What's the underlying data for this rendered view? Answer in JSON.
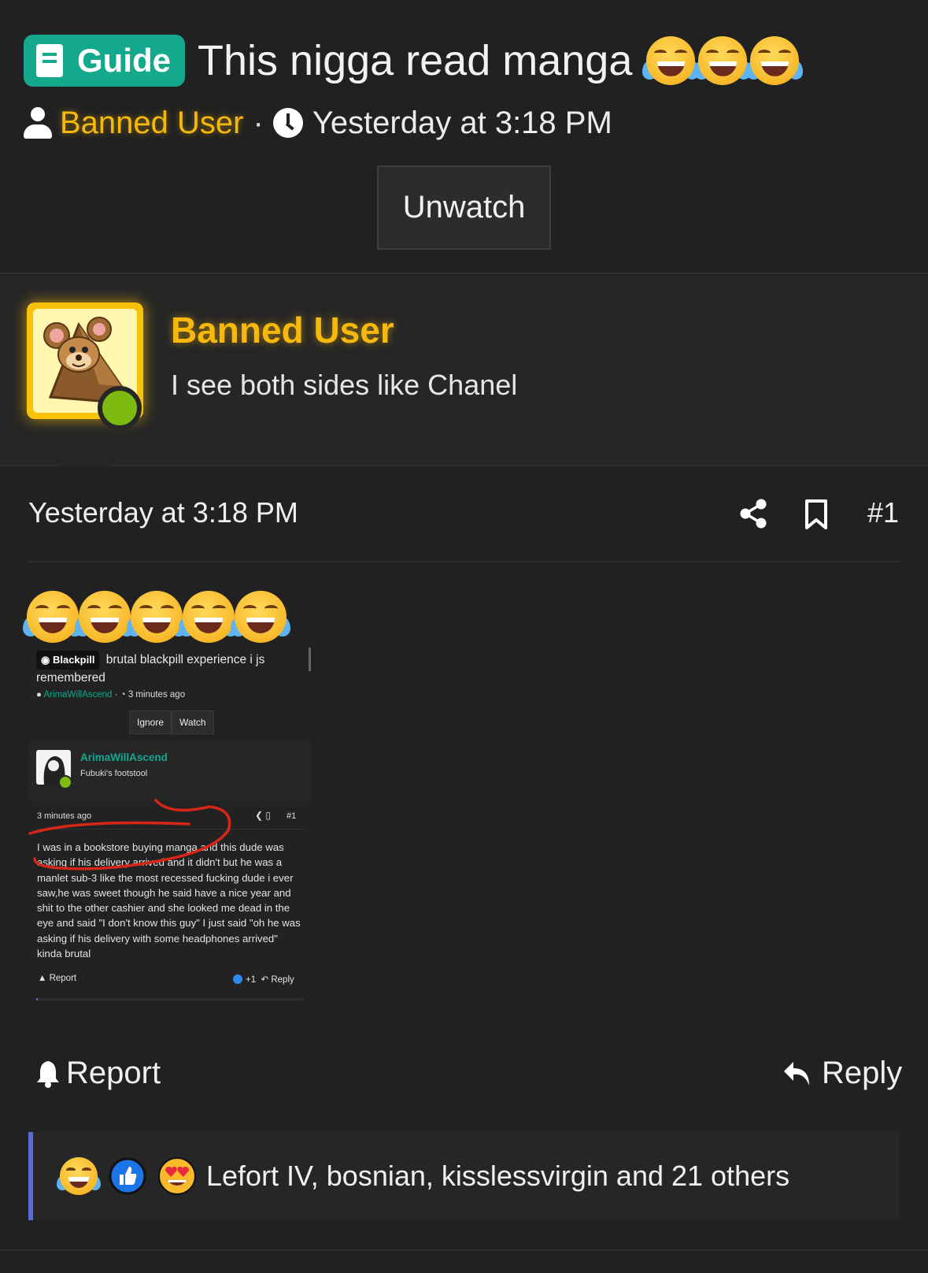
{
  "thread": {
    "prefix": "Guide",
    "title": "This nigga read manga",
    "title_emoji_count": 3,
    "author": "Banned User",
    "separator": "·",
    "time": "Yesterday at 3:18 PM",
    "unwatch_label": "Unwatch"
  },
  "post": {
    "author": "Banned User",
    "user_title": "I see both sides like Chanel",
    "online": true,
    "time": "Yesterday at 3:18 PM",
    "number": "#1",
    "emoji_count": 5,
    "report_label": "Report",
    "reply_label": "Reply"
  },
  "embedded_screenshot": {
    "prefix": "Blackpill",
    "title": "brutal blackpill experience i js remembered",
    "author": "ArimaWillAscend",
    "separator": "·",
    "time": "3 minutes ago",
    "ignore_label": "Ignore",
    "watch_label": "Watch",
    "user_name": "ArimaWillAscend",
    "user_title": "Fubuki's footstool",
    "post_time": "3 minutes ago",
    "post_number": "#1",
    "body": "I was in a bookstore buying manga and this dude was asking if his delivery arrived and it didn't but he was a manlet sub-3 like the most recessed fucking dude i ever saw,he was sweet though he said have a nice year and shit to the other cashier and she looked me dead in the eye and said \"I don't know this guy\" I just said \"oh he was asking if his delivery with some headphones arrived\" kinda brutal",
    "report_label": "Report",
    "like_count": "+1",
    "reply_label": "Reply"
  },
  "reactions": {
    "icons": [
      "joy-emoji-icon",
      "like-icon",
      "heart-eyes-emoji-icon"
    ],
    "text": "Lefort IV, bosnian, kisslessvirgin and 21 others"
  },
  "colors": {
    "background": "#212121",
    "prefix_bg": "#14a88d",
    "banned_gold": "#f6b80b",
    "online_green": "#7dbb10",
    "reactions_accent": "#5b6bd4"
  }
}
